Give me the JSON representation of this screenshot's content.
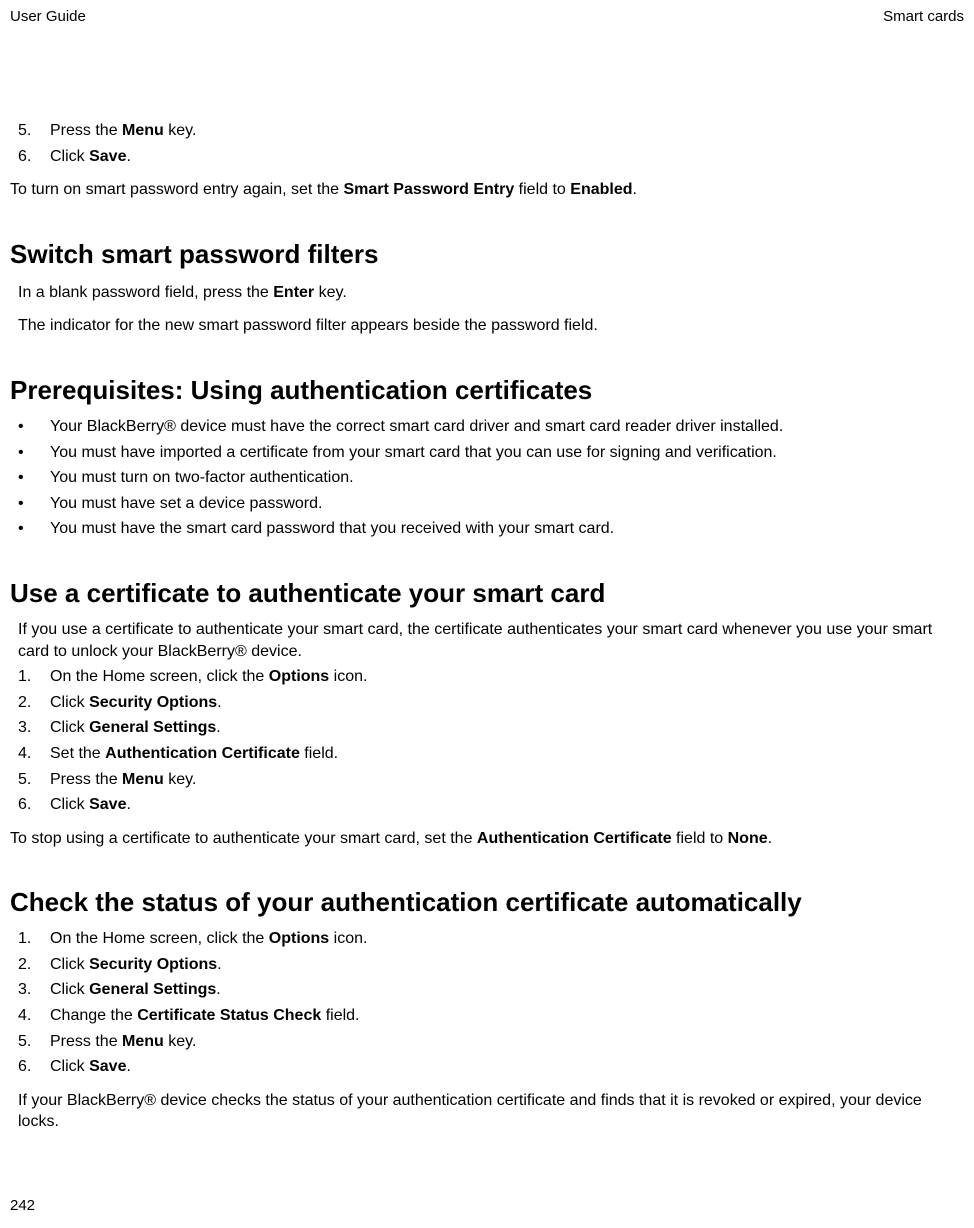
{
  "header": {
    "left": "User Guide",
    "right": "Smart cards"
  },
  "intro_steps": [
    {
      "num": "5.",
      "parts": [
        "Press the ",
        "Menu",
        " key."
      ]
    },
    {
      "num": "6.",
      "parts": [
        "Click ",
        "Save",
        "."
      ]
    }
  ],
  "intro_after": {
    "parts": [
      "To turn on smart password entry again, set the ",
      "Smart Password Entry",
      " field to ",
      "Enabled",
      "."
    ]
  },
  "section1": {
    "heading": "Switch smart password filters",
    "p1": {
      "parts": [
        "In a blank password field, press the ",
        "Enter",
        " key."
      ]
    },
    "p2": {
      "parts": [
        "The indicator for the new smart password filter appears beside the password field."
      ]
    }
  },
  "section2": {
    "heading": "Prerequisites: Using authentication certificates",
    "bullets": [
      {
        "parts": [
          "Your BlackBerry® device must have the correct smart card driver and smart card reader driver installed."
        ]
      },
      {
        "parts": [
          "You must have imported a certificate from your smart card that you can use for signing and verification."
        ]
      },
      {
        "parts": [
          "You must turn on two-factor authentication."
        ]
      },
      {
        "parts": [
          "You must have set a device password."
        ]
      },
      {
        "parts": [
          "You must have the smart card password that you received with your smart card."
        ]
      }
    ]
  },
  "section3": {
    "heading": "Use a certificate to authenticate your smart card",
    "intro": {
      "parts": [
        "If you use a certificate to authenticate your smart card, the certificate authenticates your smart card whenever you use your smart card to unlock your BlackBerry® device."
      ]
    },
    "steps": [
      {
        "num": "1.",
        "parts": [
          "On the Home screen, click the ",
          "Options",
          " icon."
        ]
      },
      {
        "num": "2.",
        "parts": [
          "Click ",
          "Security Options",
          "."
        ]
      },
      {
        "num": "3.",
        "parts": [
          "Click ",
          "General Settings",
          "."
        ]
      },
      {
        "num": "4.",
        "parts": [
          "Set the ",
          "Authentication Certificate",
          " field."
        ]
      },
      {
        "num": "5.",
        "parts": [
          "Press the ",
          "Menu",
          " key."
        ]
      },
      {
        "num": "6.",
        "parts": [
          "Click ",
          "Save",
          "."
        ]
      }
    ],
    "after": {
      "parts": [
        "To stop using a certificate to authenticate your smart card, set the ",
        "Authentication Certificate",
        " field to ",
        "None",
        "."
      ]
    }
  },
  "section4": {
    "heading": "Check the status of your authentication certificate automatically",
    "steps": [
      {
        "num": "1.",
        "parts": [
          "On the Home screen, click the ",
          "Options",
          " icon."
        ]
      },
      {
        "num": "2.",
        "parts": [
          "Click ",
          "Security Options",
          "."
        ]
      },
      {
        "num": "3.",
        "parts": [
          "Click ",
          "General Settings",
          "."
        ]
      },
      {
        "num": "4.",
        "parts": [
          "Change the ",
          "Certificate Status Check",
          " field."
        ]
      },
      {
        "num": "5.",
        "parts": [
          "Press the ",
          "Menu",
          " key."
        ]
      },
      {
        "num": "6.",
        "parts": [
          "Click ",
          "Save",
          "."
        ]
      }
    ],
    "after": {
      "parts": [
        "If your BlackBerry® device checks the status of your authentication certificate and finds that it is revoked or expired, your device locks."
      ]
    }
  },
  "page_number": "242"
}
